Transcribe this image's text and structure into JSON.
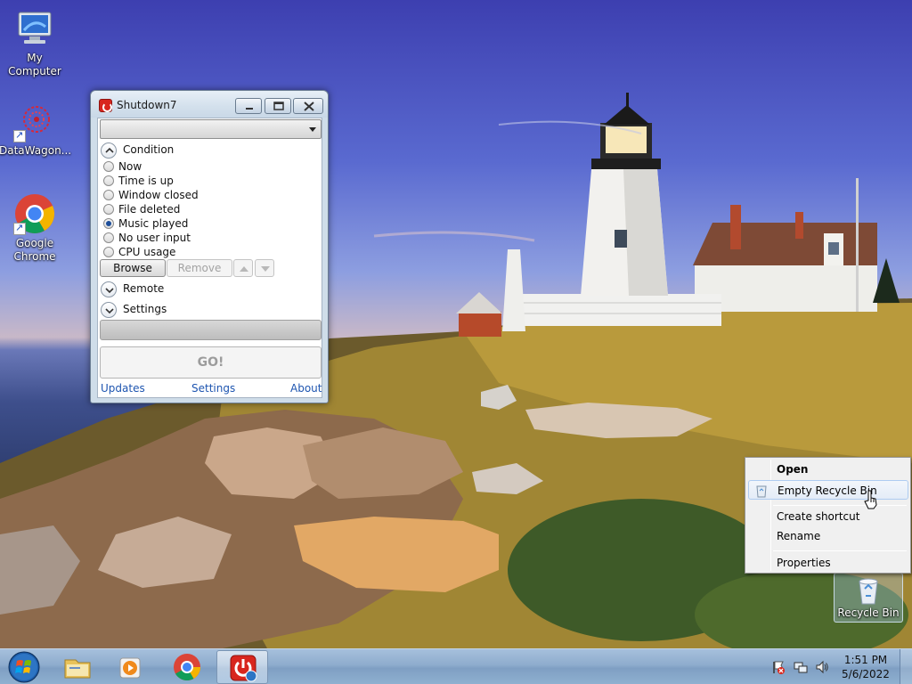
{
  "desktop": {
    "icons": [
      {
        "name": "my-computer-icon",
        "label": "My Computer"
      },
      {
        "name": "datawagon-icon",
        "label": "DataWagon..."
      },
      {
        "name": "google-chrome-icon",
        "label": "Google Chrome"
      },
      {
        "name": "recycle-bin-icon",
        "label": "Recycle Bin"
      }
    ]
  },
  "window": {
    "title": "Shutdown7",
    "combo_value": "",
    "sections": {
      "condition": "Condition",
      "remote": "Remote",
      "settings": "Settings"
    },
    "conditions": [
      {
        "label": "Now",
        "checked": false
      },
      {
        "label": "Time is up",
        "checked": false
      },
      {
        "label": "Window closed",
        "checked": false
      },
      {
        "label": "File deleted",
        "checked": false
      },
      {
        "label": "Music played",
        "checked": true
      },
      {
        "label": "No user input",
        "checked": false
      },
      {
        "label": "CPU usage",
        "checked": false
      }
    ],
    "buttons": {
      "browse": "Browse",
      "remove": "Remove",
      "go": "GO!"
    },
    "footer": {
      "updates": "Updates",
      "settings": "Settings",
      "about": "About"
    }
  },
  "context_menu": {
    "items": [
      {
        "label": "Open",
        "bold": true
      },
      {
        "label": "Empty Recycle Bin",
        "hover": true
      },
      {
        "label": "Create shortcut"
      },
      {
        "label": "Rename"
      },
      {
        "label": "Properties"
      }
    ]
  },
  "taskbar": {
    "pinned": [
      "windows-explorer-icon",
      "media-player-icon",
      "chrome-icon",
      "shutdown7-icon"
    ],
    "tray": [
      "action-center-icon",
      "network-icon",
      "volume-icon"
    ],
    "clock": {
      "time": "1:51 PM",
      "date": "5/6/2022"
    }
  }
}
